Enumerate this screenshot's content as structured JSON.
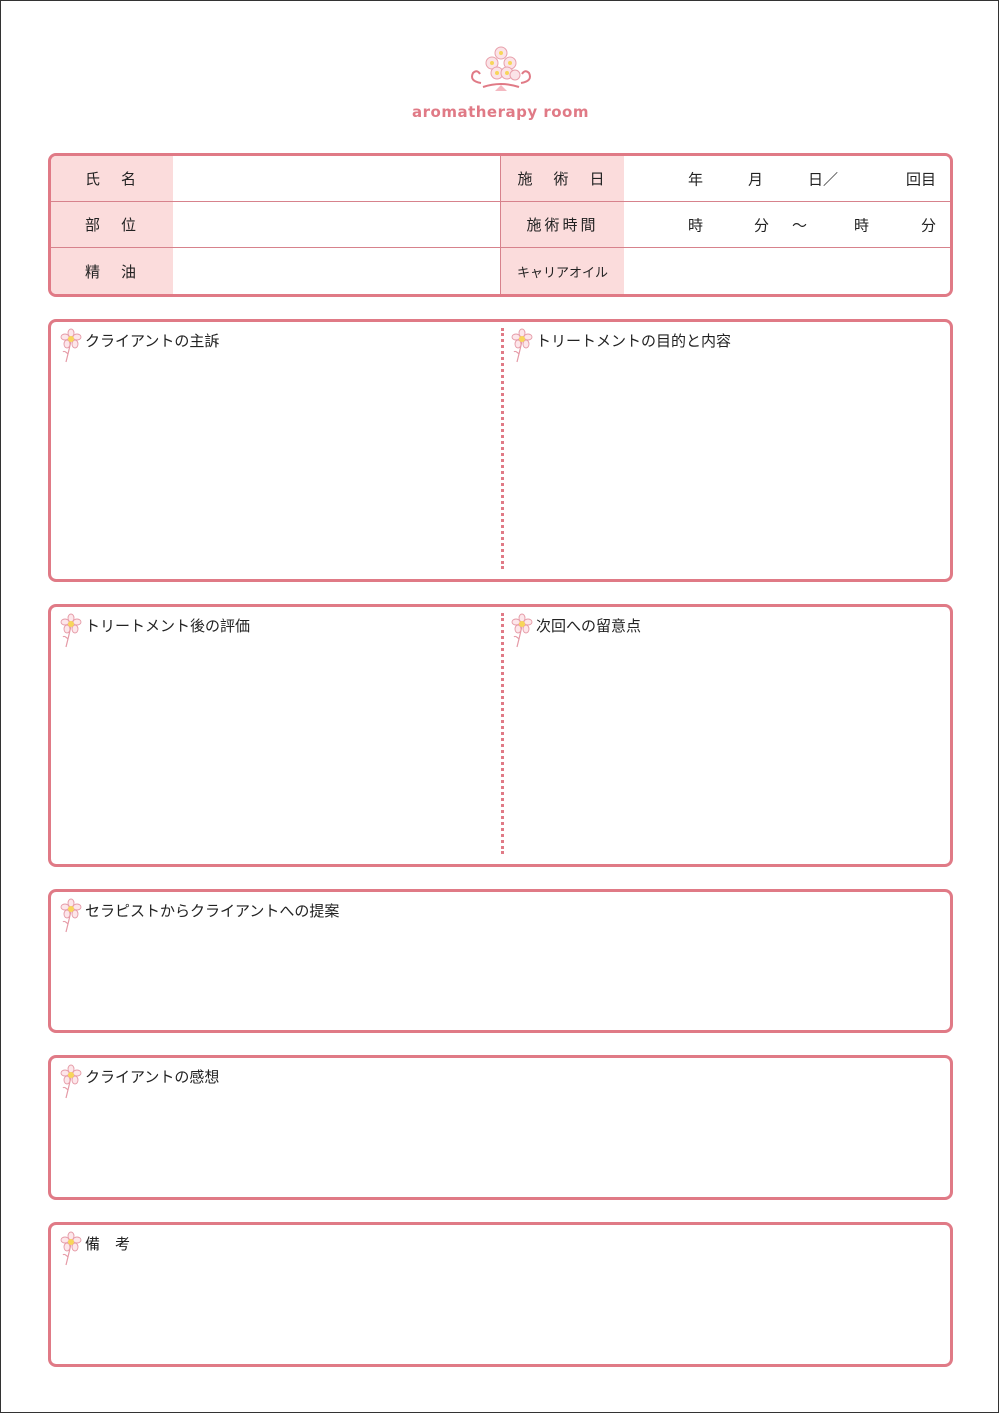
{
  "logo": {
    "text": "aromatherapy room",
    "icon": "flower-bouquet-icon",
    "color": "#e07a86"
  },
  "info": {
    "rows": [
      {
        "left_label": "氏　名",
        "right_label": "施　術　日"
      },
      {
        "left_label": "部　位",
        "right_label": "施術時間"
      },
      {
        "left_label": "精　油",
        "right_label": "キャリアオイル"
      }
    ],
    "date_fields": {
      "year": "年",
      "month": "月",
      "day": "日／",
      "count": "回目"
    },
    "time_fields": {
      "start_hour": "時",
      "start_min": "分",
      "tilde": "～",
      "end_hour": "時",
      "end_min": "分"
    }
  },
  "sections": {
    "complaint": "クライアントの主訴",
    "purpose": "トリートメントの目的と内容",
    "evaluation": "トリートメント後の評価",
    "next_notes": "次回への留意点",
    "proposal": "セラピストからクライアントへの提案",
    "impression": "クライアントの感想",
    "remarks": "備　考"
  },
  "colors": {
    "accent": "#e07a86",
    "label_bg": "#fbdcdc"
  }
}
